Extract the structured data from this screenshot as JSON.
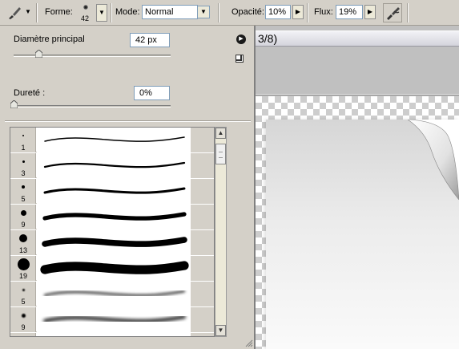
{
  "options_bar": {
    "forme_label": "Forme:",
    "brush_size": "42",
    "mode_label": "Mode:",
    "mode_value": "Normal",
    "opacite_label": "Opacité:",
    "opacite_value": "10%",
    "flux_label": "Flux:",
    "flux_value": "19%"
  },
  "document": {
    "title_fragment": "3/8)"
  },
  "palette": {
    "diameter_label": "Diamètre principal",
    "diameter_value": "42 px",
    "diameter_slider_fraction": 0.16,
    "hardness_label": "Dureté :",
    "hardness_value": "0%",
    "hardness_slider_fraction": 0.0,
    "presets": [
      {
        "size": "1",
        "tip": 2,
        "softness": 0
      },
      {
        "size": "3",
        "tip": 3,
        "softness": 0
      },
      {
        "size": "5",
        "tip": 4,
        "softness": 0
      },
      {
        "size": "9",
        "tip": 7,
        "softness": 0
      },
      {
        "size": "13",
        "tip": 10,
        "softness": 0
      },
      {
        "size": "19",
        "tip": 15,
        "softness": 0
      },
      {
        "size": "5",
        "tip": 3,
        "softness": 1
      },
      {
        "size": "9",
        "tip": 5,
        "softness": 1
      },
      {
        "size": "",
        "tip": 0,
        "softness": 1
      }
    ]
  }
}
